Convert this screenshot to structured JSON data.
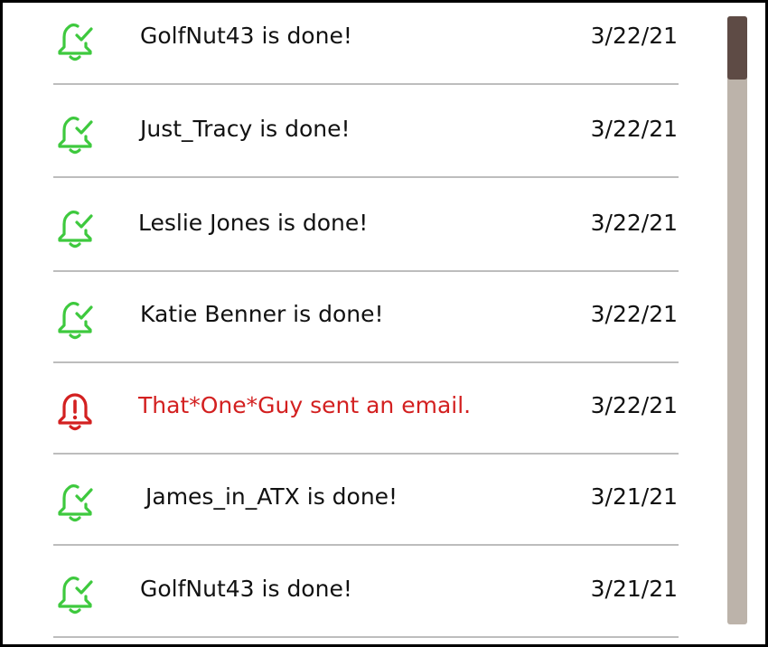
{
  "notifications": [
    {
      "message": "GolfNut43 is done!",
      "date": "3/22/21",
      "status": "done",
      "icon": "bell-check-icon"
    },
    {
      "message": "Just_Tracy is done!",
      "date": "3/22/21",
      "status": "done",
      "icon": "bell-check-icon"
    },
    {
      "message": "Leslie Jones is done!",
      "date": "3/22/21",
      "status": "done",
      "icon": "bell-check-icon"
    },
    {
      "message": "Katie Benner is done!",
      "date": "3/22/21",
      "status": "done",
      "icon": "bell-check-icon"
    },
    {
      "message": "That*One*Guy sent an email.",
      "date": "3/22/21",
      "status": "alert",
      "icon": "bell-alert-icon"
    },
    {
      "message": "James_in_ATX is done!",
      "date": "3/21/21",
      "status": "done",
      "icon": "bell-check-icon"
    },
    {
      "message": "GolfNut43 is done!",
      "date": "3/21/21",
      "status": "done",
      "icon": "bell-check-icon"
    }
  ],
  "colors": {
    "done": "#3ec93e",
    "alert": "#d32020",
    "text": "#111111",
    "scroll_track": "#bcb3aa",
    "scroll_thumb": "#5e4b45"
  }
}
